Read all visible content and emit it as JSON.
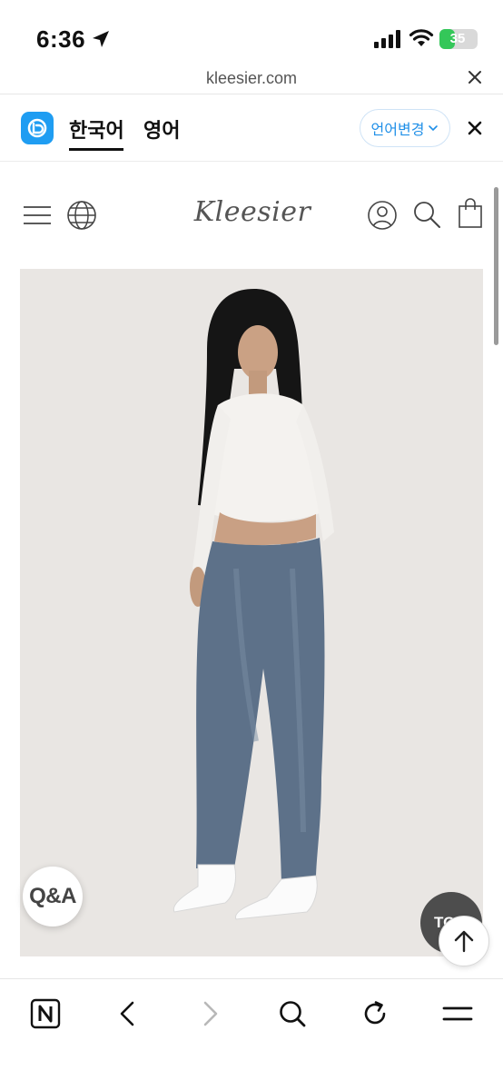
{
  "status_bar": {
    "time": "6:36",
    "battery": "35",
    "battery_level": 0.35,
    "icons": [
      "location-arrow-icon",
      "cellular-signal-icon",
      "wifi-icon",
      "battery-icon"
    ]
  },
  "url_bar": {
    "url": "kleesier.com",
    "close_icon": "close-icon"
  },
  "translate_bar": {
    "logo_icon": "papago-logo",
    "tabs": [
      {
        "label": "한국어",
        "selected": true
      },
      {
        "label": "영어",
        "selected": false
      }
    ],
    "change_language_label": "언어변경",
    "accent_color": "#1f8fe8"
  },
  "site_header": {
    "brand": "Kleesier",
    "left_icons": [
      "menu-icon",
      "globe-icon"
    ],
    "right_icons": [
      "user-icon",
      "search-icon",
      "shopping-bag-icon"
    ]
  },
  "product": {
    "image": "product-photo",
    "background_color": "#e9e6e3"
  },
  "floating": {
    "qa_label": "Q&A",
    "top_label": "TO",
    "scroll_up_icon": "arrow-up-icon"
  },
  "bottom_toolbar": {
    "icons": [
      "naver-home-icon",
      "back-icon",
      "forward-icon",
      "search-icon",
      "reload-icon",
      "menu-icon"
    ]
  }
}
